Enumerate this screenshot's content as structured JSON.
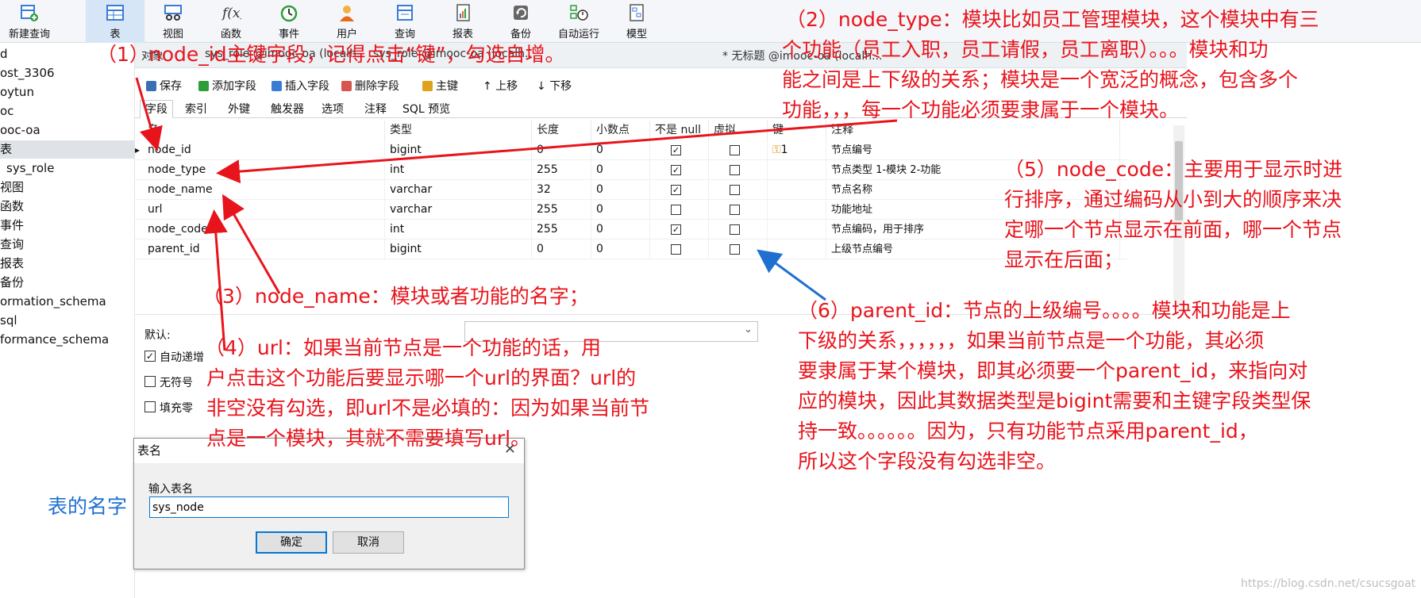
{
  "ribbon": {
    "buttons": [
      {
        "label": "新建查询",
        "icon": "new-query-icon"
      },
      {
        "label": "表",
        "icon": "table-icon"
      },
      {
        "label": "视图",
        "icon": "view-icon"
      },
      {
        "label": "函数",
        "icon": "function-icon"
      },
      {
        "label": "事件",
        "icon": "event-clock-icon"
      },
      {
        "label": "用户",
        "icon": "user-icon"
      },
      {
        "label": "查询",
        "icon": "query-icon"
      },
      {
        "label": "报表",
        "icon": "report-icon"
      },
      {
        "label": "备份",
        "icon": "backup-icon"
      },
      {
        "label": "自动运行",
        "icon": "autorun-icon"
      },
      {
        "label": "模型",
        "icon": "model-icon"
      }
    ]
  },
  "nav": {
    "items": [
      "d",
      "ost_3306",
      "oytun",
      "oc",
      "ooc-oa",
      "表",
      "sys_role",
      "视图",
      "函数",
      "事件",
      "查询",
      "报表",
      "备份",
      "ormation_schema",
      "sql",
      "formance_schema"
    ]
  },
  "tabbar": {
    "tabs": [
      "对象",
      "sys_role @imooc-oa (localh...",
      "sys_role @imooc-oa (localh...",
      "* 无标题 @imooc-oa (localh..."
    ]
  },
  "toolbar": {
    "save": "保存",
    "add_field": "添加字段",
    "insert_field": "插入字段",
    "delete_field": "删除字段",
    "primary_key": "主键",
    "move_up": "上移",
    "move_down": "下移"
  },
  "subtabs": [
    "字段",
    "索引",
    "外键",
    "触发器",
    "选项",
    "注释",
    "SQL 预览"
  ],
  "grid": {
    "headers": [
      "名",
      "类型",
      "长度",
      "小数点",
      "不是 null",
      "虚拟",
      "键",
      "注释"
    ],
    "rows": [
      {
        "name": "node_id",
        "type": "bigint",
        "length": "0",
        "decimals": "0",
        "not_null": true,
        "virtual": false,
        "key": "1",
        "comment": "节点编号"
      },
      {
        "name": "node_type",
        "type": "int",
        "length": "255",
        "decimals": "0",
        "not_null": true,
        "virtual": false,
        "key": "",
        "comment": "节点类型 1-模块 2-功能"
      },
      {
        "name": "node_name",
        "type": "varchar",
        "length": "32",
        "decimals": "0",
        "not_null": true,
        "virtual": false,
        "key": "",
        "comment": "节点名称"
      },
      {
        "name": "url",
        "type": "varchar",
        "length": "255",
        "decimals": "0",
        "not_null": false,
        "virtual": false,
        "key": "",
        "comment": "功能地址"
      },
      {
        "name": "node_code",
        "type": "int",
        "length": "255",
        "decimals": "0",
        "not_null": true,
        "virtual": false,
        "key": "",
        "comment": "节点编码，用于排序"
      },
      {
        "name": "parent_id",
        "type": "bigint",
        "length": "0",
        "decimals": "0",
        "not_null": false,
        "virtual": false,
        "key": "",
        "comment": "上级节点编号"
      }
    ]
  },
  "props": {
    "default_label": "默认:",
    "auto_increment": "自动递增",
    "unsigned": "无符号",
    "zerofill": "填充零",
    "auto_increment_checked": true
  },
  "dialog": {
    "title": "表名",
    "close": "✕",
    "input_label": "输入表名",
    "input_value": "sys_node",
    "ok": "确定",
    "cancel": "取消"
  },
  "annotations": {
    "a1": "（1）node_id主键字段，记得点击“键”，勾选自增。",
    "a2_l1": "（2）node_type：模块比如员工管理模块，这个模块中有三",
    "a2_l2": "个功能（员工入职，员工请假，员工离职）。。。模块和功",
    "a2_l3": "能之间是上下级的关系；模块是一个宽泛的概念，包含多个",
    "a2_l4": "功能，，，每一个功能必须要隶属于一个模块。",
    "a3": "（3）node_name：模块或者功能的名字；",
    "a4_l1": "（4）url：如果当前节点是一个功能的话，用",
    "a4_l2": "户点击这个功能后要显示哪一个url的界面？url的",
    "a4_l3": "非空没有勾选，即url不是必填的：因为如果当前节",
    "a4_l4": "点是一个模块，其就不需要填写url。",
    "a5_l1": "（5）node_code：主要用于显示时进",
    "a5_l2": "行排序，通过编码从小到大的顺序来决",
    "a5_l3": "定哪一个节点显示在前面，哪一个节点",
    "a5_l4": "显示在后面；",
    "a6_l1": "（6）parent_id：节点的上级编号。。。。模块和功能是上",
    "a6_l2": "下级的关系，，，，，，如果当前节点是一个功能，其必须",
    "a6_l3": "要隶属于某个模块，即其必须要一个parent_id，来指向对",
    "a6_l4": "应的模块，因此其数据类型是bigint需要和主键字段类型保",
    "a6_l5": "持一致。。。。。。因为，只有功能节点采用parent_id，",
    "a6_l6": "所以这个字段没有勾选非空。",
    "table_name_hint": "表的名字"
  },
  "watermark": "https://blog.csdn.net/csucsgoat",
  "colors": {
    "annotation_red": "#e8141c",
    "annotation_blue": "#1f6fd0",
    "selection": "#0078d7"
  }
}
